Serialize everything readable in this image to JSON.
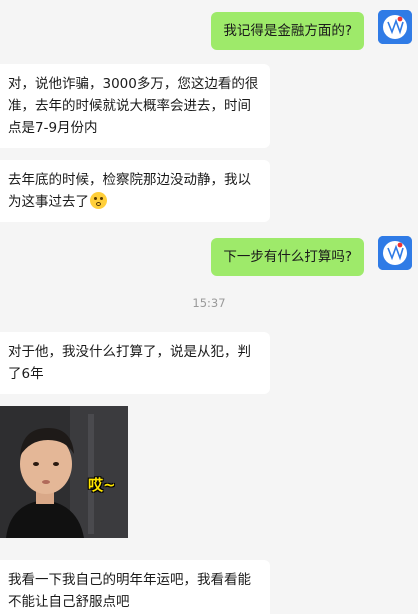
{
  "messages": [
    {
      "side": "out",
      "text": "我记得是金融方面的?"
    },
    {
      "side": "in",
      "text": "对，说他诈骗，3000多万，您这边看的很准，去年的时候就说大概率会进去，时间点是7-9月份内"
    },
    {
      "side": "in",
      "text": "去年底的时候，检察院那边没动静，我以为这事过去了",
      "emoji": "flushed-face-emoji"
    },
    {
      "side": "out",
      "text": "下一步有什么打算吗?"
    },
    {
      "side": "in",
      "text": "对于他，我没什么打算了，说是从犯，判了6年"
    },
    {
      "side": "in",
      "text": "我看一下我自己的明年年运吧，我看看能不能让自己舒服点吧"
    }
  ],
  "timestamp": "15:37",
  "sticker": {
    "caption": "哎~",
    "icon": "child-sticker-image"
  },
  "avatar": {
    "icon": "user-avatar-icon",
    "color": "#2f7be6"
  },
  "colors": {
    "outgoing_bubble": "#9eea6a",
    "incoming_bubble": "#ffffff",
    "background": "#f5f5f5"
  }
}
